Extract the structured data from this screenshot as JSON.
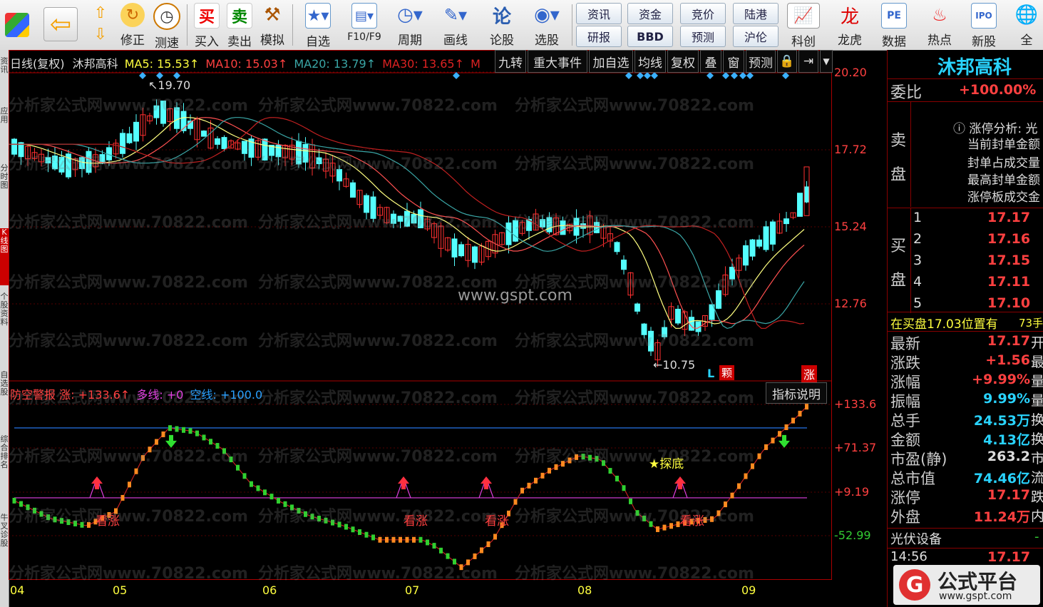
{
  "toolbar": {
    "items": [
      {
        "label": "修正",
        "icon": "refresh-icon"
      },
      {
        "label": "测速",
        "icon": "clock-icon"
      },
      {
        "label": "买入",
        "icon": "buy-icon"
      },
      {
        "label": "卖出",
        "icon": "sell-icon"
      },
      {
        "label": "模拟",
        "icon": "hammer-icon"
      },
      {
        "label": "自选",
        "icon": "star-icon"
      },
      {
        "label": "F10/F9",
        "icon": "f10-icon"
      },
      {
        "label": "周期",
        "icon": "period-clock-icon"
      },
      {
        "label": "画线",
        "icon": "pencil-icon"
      },
      {
        "label": "论股",
        "icon": "discuss-icon"
      },
      {
        "label": "选股",
        "icon": "select-stock-icon"
      },
      {
        "label": "科创",
        "icon": "kechuang-icon"
      },
      {
        "label": "龙虎",
        "icon": "dragon-tiger-icon"
      },
      {
        "label": "数据",
        "icon": "pe-data-icon"
      },
      {
        "label": "热点",
        "icon": "hot-icon"
      },
      {
        "label": "新股",
        "icon": "ipo-icon"
      },
      {
        "label": "全",
        "icon": "globe-icon"
      }
    ],
    "small_buttons": [
      "资讯",
      "资金",
      "竞价",
      "陆港",
      "研报",
      "BBD",
      "预测",
      "沪伦"
    ]
  },
  "left_tabs": [
    "资讯",
    "应用",
    "分时图",
    "K线图",
    "个股资料",
    "自选股",
    "综合排名",
    "牛叉诊股"
  ],
  "chart_header": {
    "period": "日线(复权)",
    "stock_name": "沐邦高科",
    "ma5": "MA5: 15.53↑",
    "ma10": "MA10: 15.03↑",
    "ma20": "MA20: 13.79↑",
    "ma30": "MA30: 13.65↑",
    "ma_more": "M"
  },
  "chart_buttons": [
    "九转",
    "重大事件",
    "加自选",
    "均线",
    "复权",
    "叠",
    "窗",
    "预测"
  ],
  "watermarks": {
    "main": "分析家公式网www.70822.com",
    "center": "www.gspt.com"
  },
  "price_axis": [
    "20.20",
    "17.72",
    "15.24",
    "12.76"
  ],
  "annotations": {
    "high": "19.70",
    "low": "10.75",
    "l_mark": "L",
    "tag_buy": "颗",
    "tag_zhang": "涨"
  },
  "indicator": {
    "name": "防空警报",
    "zhang": "涨: +133.6↑",
    "duoxian": "多线: +0",
    "kongxian": "空线: +100.0",
    "help_button": "指标说明",
    "axis": [
      "+133.6",
      "+71.37",
      "+9.19",
      "-52.99"
    ],
    "signal_text": "看涨",
    "bottom_signal": "★探底"
  },
  "date_axis": [
    "04",
    "05",
    "06",
    "07",
    "08",
    "09"
  ],
  "right_panel": {
    "stock_name": "沐邦高科",
    "weibi_label": "委比",
    "weibi_value": "+100.00%",
    "sell_label": "卖盘",
    "limit_analysis": [
      "涨停分析: 光",
      "当前封单金额",
      "封单占成交量",
      "最高封单金额",
      "涨停板成交金"
    ],
    "buy_label": "买盘",
    "bids": [
      {
        "level": "1",
        "price": "17.17"
      },
      {
        "level": "2",
        "price": "17.16"
      },
      {
        "level": "3",
        "price": "17.15"
      },
      {
        "level": "4",
        "price": "17.11"
      },
      {
        "level": "5",
        "price": "17.10"
      }
    ],
    "buy_position_text": "在买盘17.03位置有",
    "buy_position_hands": "73手",
    "stats": [
      {
        "label": "最新",
        "value": "17.17",
        "color": "#ff4040",
        "tail": "开"
      },
      {
        "label": "涨跌",
        "value": "+1.56",
        "color": "#ff4040",
        "tail": "最"
      },
      {
        "label": "涨幅",
        "value": "+9.99%",
        "color": "#ff4040",
        "tail": "量"
      },
      {
        "label": "振幅",
        "value": "9.99%",
        "color": "#29d3ff",
        "tail": "量"
      },
      {
        "label": "总手",
        "value": "24.53万",
        "color": "#29d3ff",
        "tail": "换"
      },
      {
        "label": "金额",
        "value": "4.13亿",
        "color": "#29d3ff",
        "tail": "换"
      },
      {
        "label": "市盈(静)",
        "value": "263.2",
        "color": "#dddddd",
        "tail": "市"
      },
      {
        "label": "总市值",
        "value": "74.46亿",
        "color": "#29d3ff",
        "tail": "流"
      },
      {
        "label": "涨停",
        "value": "17.17",
        "color": "#ff4040",
        "tail": "跌"
      },
      {
        "label": "外盘",
        "value": "11.24万",
        "color": "#ff4040",
        "tail": "内"
      }
    ],
    "sector": "光伏设备",
    "sector_tail": "-",
    "tick_time": "14:56",
    "tick_price": "17.17",
    "logo_text": "公式平台",
    "logo_url": "www.gspt.com"
  }
}
